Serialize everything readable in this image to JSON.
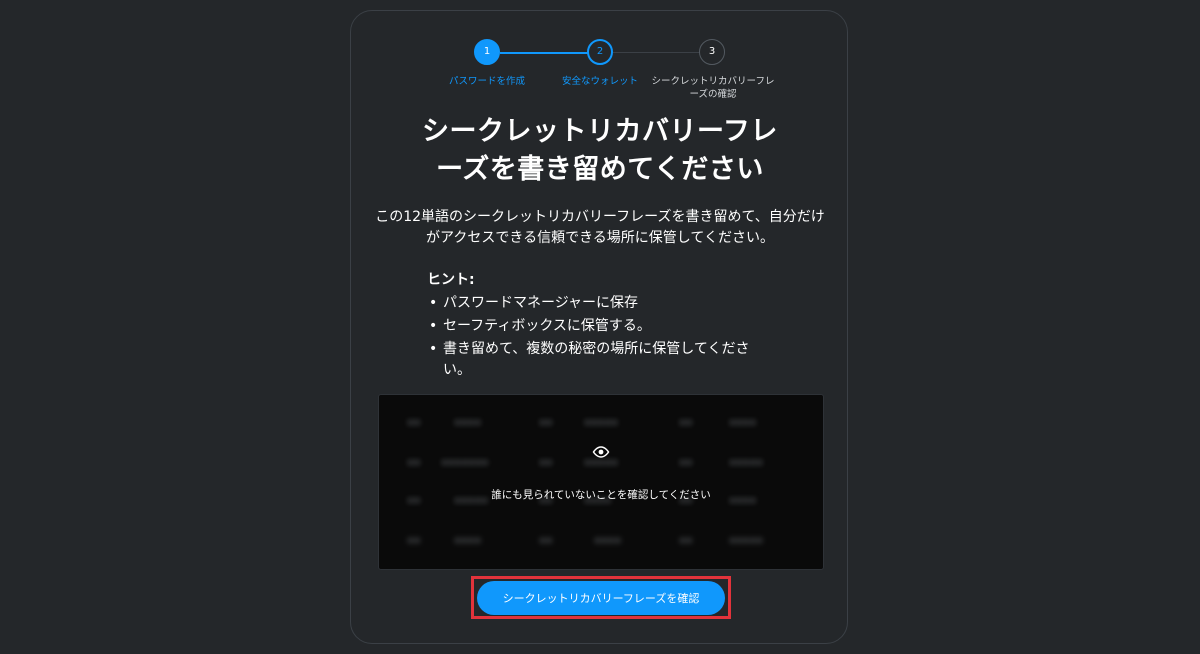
{
  "stepper": {
    "steps": [
      {
        "number": "1",
        "label": "パスワードを作成"
      },
      {
        "number": "2",
        "label": "安全なウォレット"
      },
      {
        "number": "3",
        "label": "シークレットリカバリーフレーズの確認"
      }
    ]
  },
  "title": "シークレットリカバリーフレーズを書き留めてください",
  "description": "この12単語のシークレットリカバリーフレーズを書き留めて、自分だけがアクセスできる信頼できる場所に保管してください。",
  "hints": {
    "title": "ヒント:",
    "items": [
      "パスワードマネージャーに保存",
      "セーフティボックスに保管する。",
      "書き留めて、複数の秘密の場所に保管してください。"
    ]
  },
  "phrase_box": {
    "icon": "eye-icon",
    "reveal_text": "誰にも見られていないことを確認してください"
  },
  "confirm_button": {
    "label": "シークレットリカバリーフレーズを確認"
  },
  "colors": {
    "accent": "#1098fc",
    "background": "#24272a",
    "highlight": "#e2333b"
  }
}
